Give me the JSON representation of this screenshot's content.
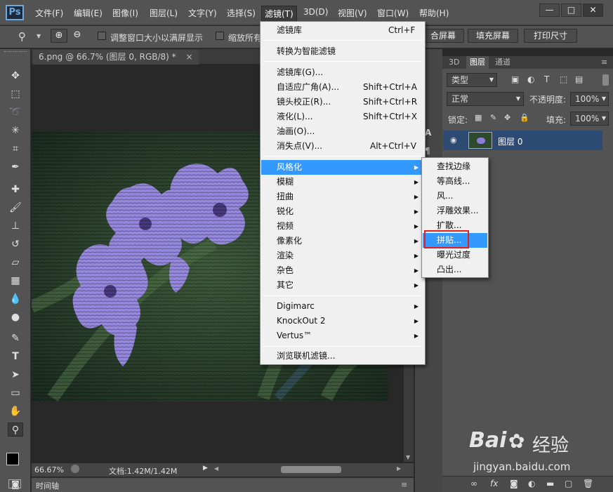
{
  "app": {
    "logo": "Ps"
  },
  "menubar": {
    "items": [
      "文件(F)",
      "编辑(E)",
      "图像(I)",
      "图层(L)",
      "文字(Y)",
      "选择(S)",
      "滤镜(T)",
      "3D(D)",
      "视图(V)",
      "窗口(W)",
      "帮助(H)"
    ],
    "active": "滤镜(T)"
  },
  "window_controls": {
    "min": "—",
    "max": "□",
    "close": "✕"
  },
  "options": {
    "check1": "调整窗口大小以满屏显示",
    "check2": "缩放所有",
    "btn_fit": "合屏幕",
    "btn_fill": "填充屏幕",
    "btn_print": "打印尺寸"
  },
  "document": {
    "tab_title": "6.png @ 66.7% (图层 0, RGB/8) *",
    "tab_close": "×"
  },
  "status": {
    "zoom": "66.67%",
    "doc": "文档:1.42M/1.42M"
  },
  "timeline": {
    "label": "时间轴"
  },
  "layers_panel": {
    "tabs": [
      "3D",
      "图层",
      "通道"
    ],
    "filter_kind": "类型",
    "blend_mode": "正常",
    "opacity_label": "不透明度:",
    "opacity_value": "100%",
    "lock_label": "锁定:",
    "fill_label": "填充:",
    "fill_value": "100%",
    "layer_name": "图层 0"
  },
  "filter_menu": {
    "top": [
      {
        "label": "滤镜库",
        "shortcut": "Ctrl+F"
      }
    ],
    "smart": [
      {
        "label": "转换为智能滤镜"
      }
    ],
    "group1": [
      {
        "label": "滤镜库(G)...",
        "shortcut": ""
      },
      {
        "label": "自适应广角(A)...",
        "shortcut": "Shift+Ctrl+A"
      },
      {
        "label": "镜头校正(R)...",
        "shortcut": "Shift+Ctrl+R"
      },
      {
        "label": "液化(L)...",
        "shortcut": "Shift+Ctrl+X"
      },
      {
        "label": "油画(O)...",
        "shortcut": ""
      },
      {
        "label": "消失点(V)...",
        "shortcut": "Alt+Ctrl+V"
      }
    ],
    "group2": [
      "风格化",
      "模糊",
      "扭曲",
      "锐化",
      "视频",
      "像素化",
      "渲染",
      "杂色",
      "其它"
    ],
    "group3": [
      "Digimarc",
      "KnockOut 2",
      "Vertus™"
    ],
    "browse": "浏览联机滤镜..."
  },
  "stylize_submenu": {
    "items": [
      "查找边缘",
      "等高线...",
      "风...",
      "浮雕效果...",
      "扩散...",
      "拼贴...",
      "曝光过度",
      "凸出..."
    ],
    "highlighted": "拼贴..."
  },
  "watermark": {
    "brand": "Bai",
    "brand2": "经验",
    "url": "jingyan.baidu.com"
  }
}
